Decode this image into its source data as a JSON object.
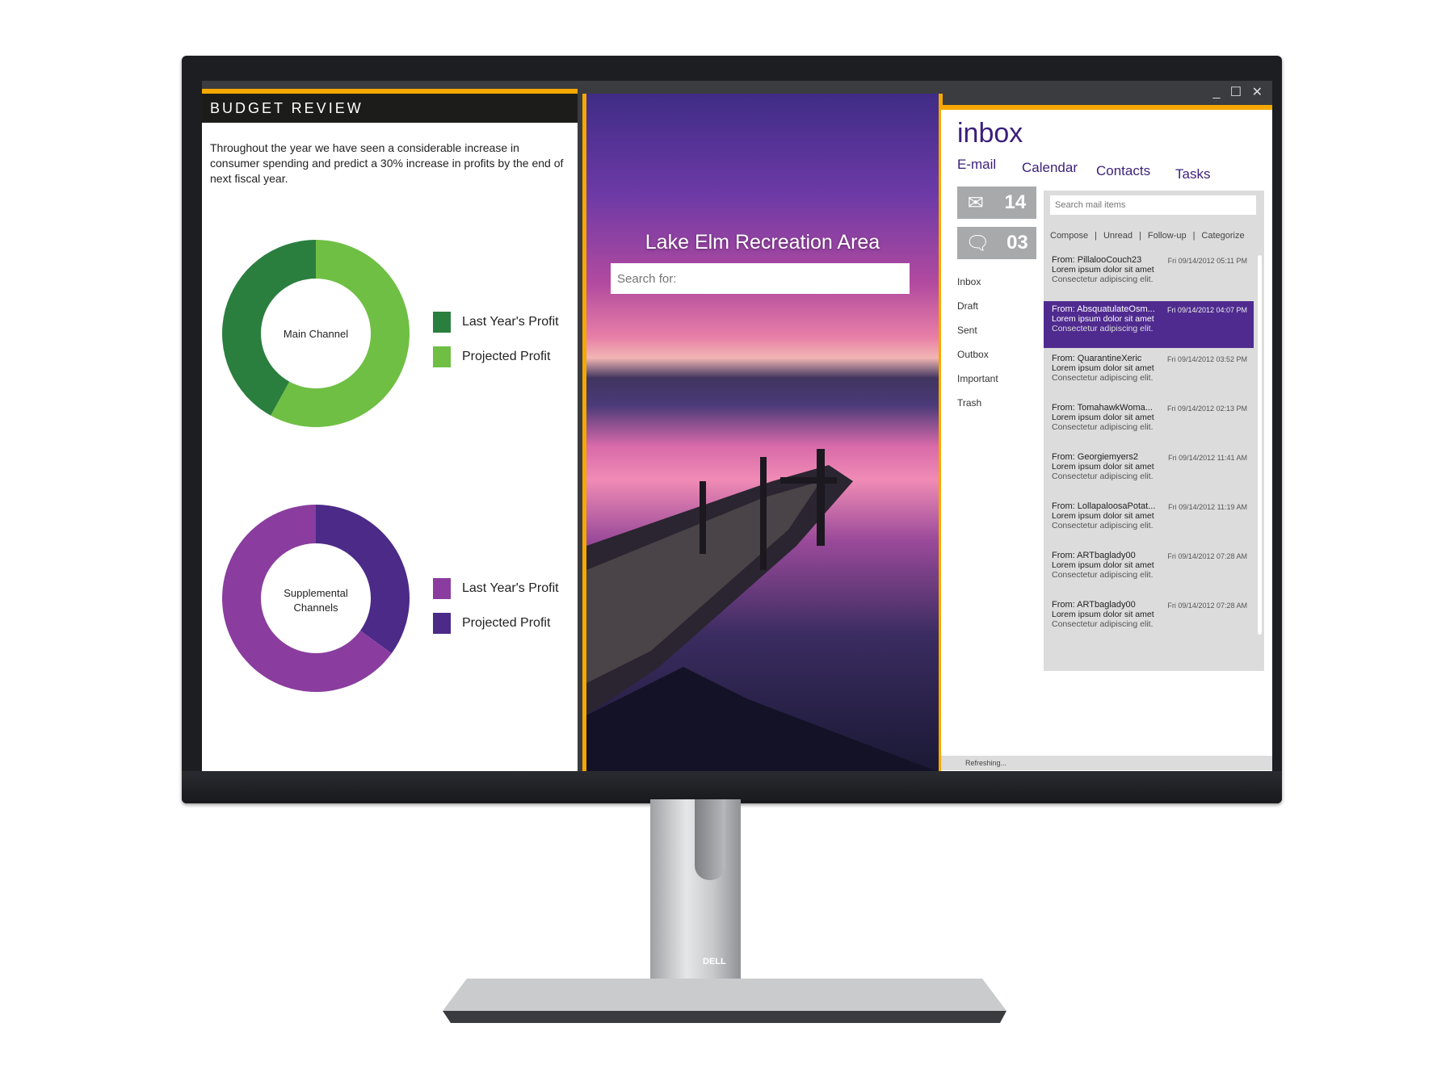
{
  "budget": {
    "header": "BUDGET REVIEW",
    "description": "Throughout the year we have seen a considerable increase in consumer spending and predict a 30% increase in profits by the end of next fiscal year.",
    "charts": [
      {
        "center_label": "Main Channel",
        "legend": [
          {
            "label": "Last Year's Profit",
            "color": "#2a7f3e",
            "value": 42
          },
          {
            "label": "Projected Profit",
            "color": "#6fbf44",
            "value": 58
          }
        ]
      },
      {
        "center_label": "Supplemental Channels",
        "legend": [
          {
            "label": "Last Year's Profit",
            "color": "#8a3d9e",
            "value": 65
          },
          {
            "label": "Projected Profit",
            "color": "#4b2a88",
            "value": 35
          }
        ]
      }
    ]
  },
  "chart_data": [
    {
      "type": "pie",
      "title": "Main Channel",
      "categories": [
        "Last Year's Profit",
        "Projected Profit"
      ],
      "values": [
        42,
        58
      ]
    },
    {
      "type": "pie",
      "title": "Supplemental Channels",
      "categories": [
        "Last Year's Profit",
        "Projected Profit"
      ],
      "values": [
        65,
        35
      ]
    }
  ],
  "photo": {
    "title": "Lake Elm Recreation Area",
    "search_placeholder": "Search for:"
  },
  "mail": {
    "title": "inbox",
    "window_controls": "_ ☐ ✕",
    "tabs": [
      "E-mail",
      "Calendar",
      "Contacts",
      "Tasks"
    ],
    "counters": [
      {
        "icon": "envelope-icon",
        "value": "14"
      },
      {
        "icon": "chat-bubble-icon",
        "value": "03"
      }
    ],
    "folders": [
      "Inbox",
      "Draft",
      "Sent",
      "Outbox",
      "Important",
      "Trash"
    ],
    "search_placeholder": "Search mail items",
    "actions": [
      "Compose",
      "|",
      "Unread",
      "|",
      "Follow-up",
      "|",
      "Categorize"
    ],
    "accent": "#4f2b8f",
    "messages": [
      {
        "from": "From: PillalooCouch23",
        "date": "Fri 09/14/2012 05:11 PM",
        "line1": "Lorem ipsum dolor sit amet",
        "line2": "Consectetur adipiscing elit."
      },
      {
        "from": "From: AbsquatulateOsm...",
        "date": "Fri 09/14/2012 04:07 PM",
        "line1": "Lorem ipsum dolor sit amet",
        "line2": "Consectetur adipiscing elit.",
        "selected": true
      },
      {
        "from": "From: QuarantineXeric",
        "date": "Fri 09/14/2012 03:52 PM",
        "line1": "Lorem ipsum dolor sit amet",
        "line2": "Consectetur adipiscing elit."
      },
      {
        "from": "From: TomahawkWoma...",
        "date": "Fri 09/14/2012 02:13 PM",
        "line1": "Lorem ipsum dolor sit amet",
        "line2": "Consectetur adipiscing elit."
      },
      {
        "from": "From: Georgiemyers2",
        "date": "Fri 09/14/2012 11:41 AM",
        "line1": "Lorem ipsum dolor sit amet",
        "line2": "Consectetur adipiscing elit."
      },
      {
        "from": "From: LollapaloosaPotat...",
        "date": "Fri 09/14/2012 11:19 AM",
        "line1": "Lorem ipsum dolor sit amet",
        "line2": "Consectetur adipiscing elit."
      },
      {
        "from": "From: ARTbaglady00",
        "date": "Fri 09/14/2012 07:28 AM",
        "line1": "Lorem ipsum dolor sit amet",
        "line2": "Consectetur adipiscing elit."
      },
      {
        "from": "From: ARTbaglady00",
        "date": "Fri 09/14/2012 07:28 AM",
        "line1": "Lorem ipsum dolor sit amet",
        "line2": "Consectetur adipiscing elit."
      }
    ],
    "status": "Refreshing..."
  },
  "monitor": {
    "brand": "DELL"
  }
}
